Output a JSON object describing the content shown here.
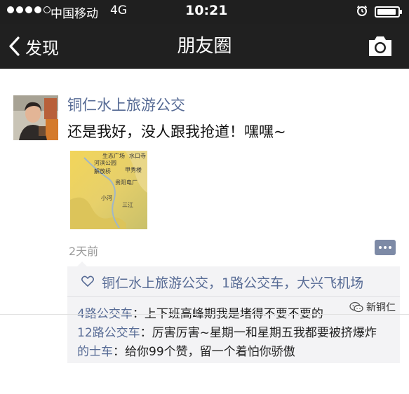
{
  "status_bar": {
    "carrier": "中国移动",
    "network": "4G",
    "time": "10:21"
  },
  "nav": {
    "back_label": "发现",
    "title": "朋友圈"
  },
  "post": {
    "author": "铜仁水上旅游公交",
    "text": "还是我好，没人跟我抢道！嘿嘿~",
    "time": "2天前",
    "map_labels": {
      "l1": "生态广场",
      "l2": "水口寺",
      "l3": "河滨公园",
      "l4": "解放桥",
      "l5": "甲秀楼",
      "l6": "贵阳电厂",
      "l7": "小河",
      "l8": "三江"
    }
  },
  "likes": {
    "text": "铜仁水上旅游公交，1路公交车，大兴飞机场"
  },
  "comments": [
    {
      "name": "4路公交车",
      "text": "上下班高峰期我是堵得不要不要的"
    },
    {
      "name": "12路公交车",
      "text": "厉害厉害~星期一和星期五我都要被挤爆炸"
    },
    {
      "name": "的士车",
      "text": "给你99个赞，留一个着怕你骄傲"
    }
  ],
  "watermark": {
    "text": "新铜仁"
  }
}
